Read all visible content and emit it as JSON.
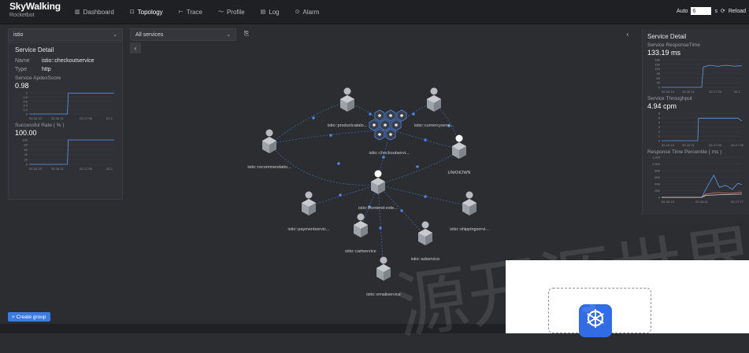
{
  "brand": {
    "name": "SkyWalking",
    "subtitle": "Rocketbot"
  },
  "nav": [
    {
      "label": "Dashboard",
      "icon": "▥",
      "active": false
    },
    {
      "label": "Topology",
      "icon": "⊡",
      "active": true
    },
    {
      "label": "Trace",
      "icon": "⊢",
      "active": false
    },
    {
      "label": "Profile",
      "icon": "〜",
      "active": false
    },
    {
      "label": "Log",
      "icon": "▤",
      "active": false
    },
    {
      "label": "Alarm",
      "icon": "⊙",
      "active": false
    }
  ],
  "auto_refresh": {
    "label": "Auto",
    "value": "6",
    "unit": "s",
    "reload_label": "Reload"
  },
  "group_select": {
    "value": "istio"
  },
  "services_select": {
    "value": "All services"
  },
  "left_panel": {
    "title": "Service Detail",
    "fields": [
      {
        "key": "Name",
        "value": "istio::checkoutservice"
      },
      {
        "key": "Type",
        "value": "http"
      }
    ],
    "apdex": {
      "label": "Service ApdexScore",
      "value": "0.98",
      "yticks": [
        "1",
        "0.8",
        "0.6",
        "0.4",
        "0.2",
        "0"
      ],
      "xticks": [
        "02-16 13",
        "02-16 21",
        "02-17 05",
        "02-1"
      ]
    },
    "success": {
      "label": "Successful Rate ( % )",
      "value": "100.00",
      "yticks": [
        "100",
        "80",
        "60",
        "40",
        "20",
        "0"
      ],
      "xticks": [
        "02-16 13",
        "02-16 21",
        "02-17 05",
        "02-1"
      ]
    }
  },
  "right_panel": {
    "title": "Service Detail",
    "response_time": {
      "label": "Service ResponseTime",
      "value": "133.19 ms",
      "yticks": [
        "180",
        "150",
        "120",
        "90",
        "60",
        "30",
        "0"
      ],
      "xticks": [
        "02-16 13",
        "02-16 21",
        "02-17 05",
        "02-1"
      ]
    },
    "throughput": {
      "label": "Service Throughput",
      "value": "4.94 cpm",
      "yticks": [
        "6",
        "5",
        "4",
        "3",
        "2",
        "1",
        "0"
      ],
      "xticks": [
        "02-16 13",
        "02-16 21",
        "02-17 05",
        "02-17 05"
      ]
    },
    "percentile": {
      "label": "Response Time Percentile ( ms )",
      "yticks": [
        "1,200",
        "1,000",
        "800",
        "600",
        "400",
        "200",
        "0"
      ],
      "xticks": [
        "02-16 13",
        "02-16 21",
        "02-17 17"
      ]
    }
  },
  "topology": {
    "center_label": "istio::checkoutservi...",
    "nodes": [
      {
        "label": "istio::productcatalo..."
      },
      {
        "label": "istio::currencyservi..."
      },
      {
        "label": "istio::recommendatio..."
      },
      {
        "label": "UNKNOWN"
      },
      {
        "label": "istio::frontend-exte..."
      },
      {
        "label": "istio::paymentservic..."
      },
      {
        "label": "istio::shippingservi..."
      },
      {
        "label": "istio::cartservice"
      },
      {
        "label": "istio::adservice"
      },
      {
        "label": "istio::emailservice"
      }
    ]
  },
  "create_group": {
    "label": "+ Create group"
  },
  "watermark": {
    "text_dark": "源开源世界",
    "text_light": "源开源"
  },
  "colors": {
    "accent": "#3d7be0",
    "node": "#b9bcc2",
    "link": "#4a7fd4"
  }
}
